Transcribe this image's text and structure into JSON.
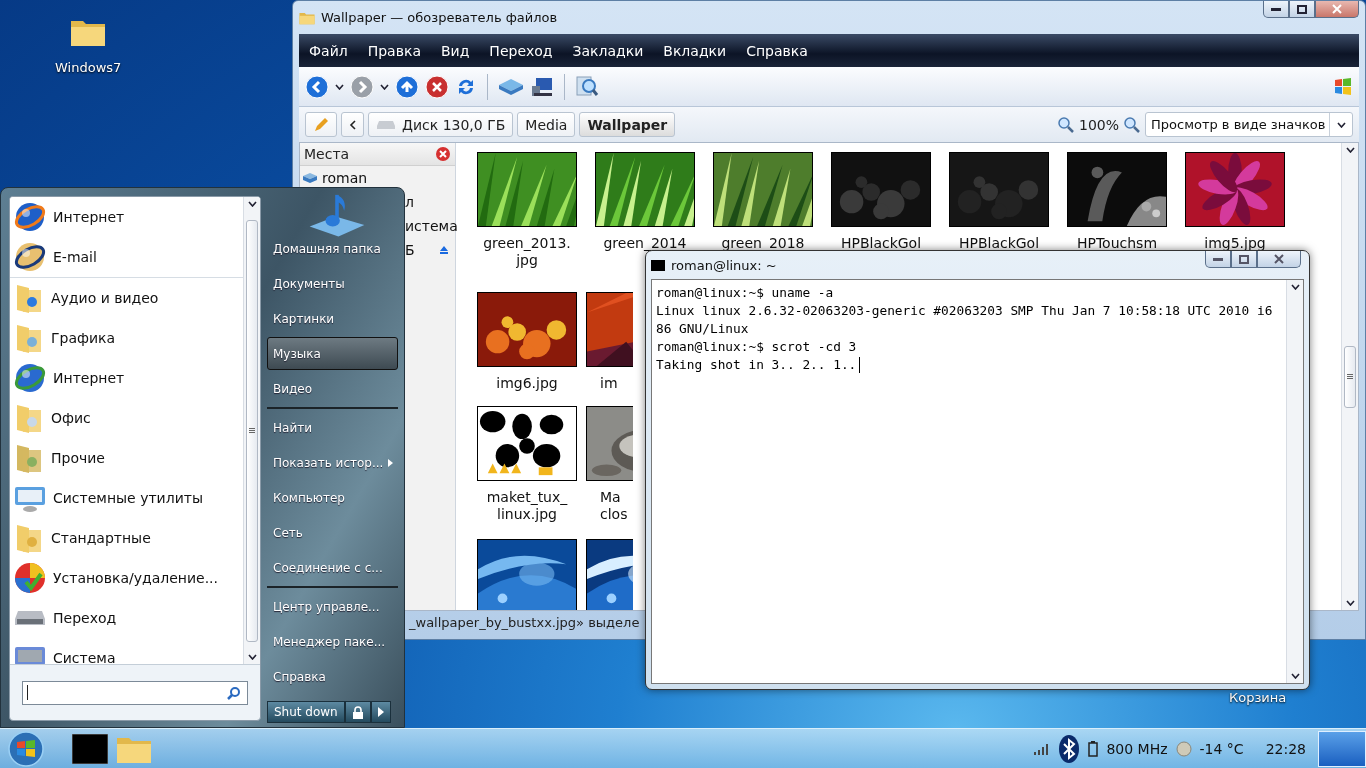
{
  "desktop": {
    "folder_label": "Windows7",
    "trash_label": "Корзина"
  },
  "file_manager": {
    "title": "Wallpaper — обозреватель файлов",
    "menu": [
      "Файл",
      "Правка",
      "Вид",
      "Переход",
      "Закладки",
      "Вкладки",
      "Справка"
    ],
    "breadcrumbs": [
      {
        "label": "Диск 130,0 ГБ",
        "selected": false
      },
      {
        "label": "Media",
        "selected": false
      },
      {
        "label": "Wallpaper",
        "selected": true
      }
    ],
    "zoom": "100%",
    "view_mode": "Просмотр в виде значков",
    "places": {
      "title": "Места",
      "items": [
        {
          "label": "roman",
          "eject": false
        },
        {
          "label": "л",
          "eject": false
        },
        {
          "label": "истема",
          "eject": false
        },
        {
          "label": "Б",
          "eject": true
        }
      ]
    },
    "file_rows": [
      {
        "items": [
          {
            "kind": "picture",
            "lines": [
              "green_2013.",
              "jpg"
            ]
          },
          {
            "kind": "picture",
            "lines": [
              "green_2014"
            ]
          },
          {
            "kind": "picture",
            "lines": [
              "green_2018"
            ]
          },
          {
            "kind": "picture",
            "lines": [
              "HPBlackGol"
            ]
          },
          {
            "kind": "picture",
            "lines": [
              "HPBlackGol"
            ]
          },
          {
            "kind": "picture",
            "lines": [
              "HPTouchsm"
            ]
          },
          {
            "kind": "picture",
            "lines": [
              "img5.jpg"
            ]
          }
        ]
      },
      {
        "items": [
          {
            "kind": "picture",
            "lines": [
              "img6.jpg"
            ]
          },
          {
            "kind": "picture",
            "lines": [
              "im"
            ]
          }
        ]
      },
      {
        "items": [
          {
            "kind": "picture",
            "lines": [
              "maket_tux_",
              "linux.jpg"
            ]
          },
          {
            "kind": "picture",
            "lines": [
              "Ma",
              "clos"
            ]
          }
        ]
      },
      {
        "items": [
          {
            "kind": "picture"
          },
          {
            "kind": "picture"
          }
        ]
      }
    ],
    "status": "_wallpaper_by_bustxx.jpg» выделе"
  },
  "start_menu": {
    "program_groups": [
      {
        "items": [
          {
            "label": "Интернет"
          },
          {
            "label": "E-mail"
          }
        ]
      },
      {
        "items": [
          {
            "label": "Аудио и видео"
          },
          {
            "label": "Графика"
          },
          {
            "label": "Интернет"
          },
          {
            "label": "Офис"
          },
          {
            "label": "Прочие"
          },
          {
            "label": "Системные утилиты"
          },
          {
            "label": "Стандартные"
          },
          {
            "label": "Установка/удаление..."
          },
          {
            "label": "Переход"
          },
          {
            "label": "Система"
          }
        ]
      }
    ],
    "place_groups": [
      {
        "items": [
          {
            "label": "Домашняя папка",
            "selected": false,
            "submenu": false
          },
          {
            "label": "Документы",
            "selected": false,
            "submenu": false
          },
          {
            "label": "Картинки",
            "selected": false,
            "submenu": false
          },
          {
            "label": "Музыка",
            "selected": true,
            "submenu": false
          },
          {
            "label": "Видео",
            "selected": false,
            "submenu": false
          }
        ]
      },
      {
        "items": [
          {
            "label": "Найти",
            "selected": false,
            "submenu": false
          },
          {
            "label": "Показать истор...",
            "selected": false,
            "submenu": true
          },
          {
            "label": "Компьютер",
            "selected": false,
            "submenu": false
          },
          {
            "label": "Сеть",
            "selected": false,
            "submenu": false
          },
          {
            "label": "Соединение с с...",
            "selected": false,
            "submenu": false
          }
        ]
      },
      {
        "items": [
          {
            "label": "Центр управле...",
            "selected": false,
            "submenu": false
          },
          {
            "label": "Менеджер паке...",
            "selected": false,
            "submenu": false
          },
          {
            "label": "Справка",
            "selected": false,
            "submenu": false
          }
        ]
      }
    ],
    "shutdown": "Shut down"
  },
  "terminal": {
    "title": "roman@linux: ~",
    "lines": [
      "roman@linux:~$ uname -a",
      "Linux linux 2.6.32-02063203-generic #02063203 SMP Thu Jan 7 10:58:18 UTC 2010 i6",
      "86 GNU/Linux",
      "roman@linux:~$ scrot -cd 3",
      "Taking shot in 3.. 2.. 1.."
    ]
  },
  "taskbar": {
    "cpu": "800 MHz",
    "weather": "-14 °C",
    "clock": "22:28"
  }
}
